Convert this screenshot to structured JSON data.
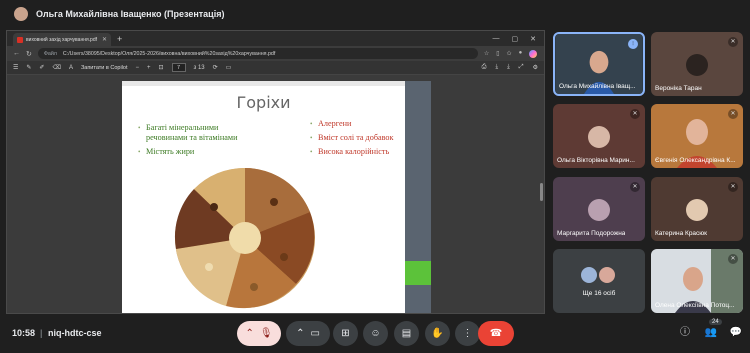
{
  "meeting": {
    "presenter_title": "Ольга Михайлівна Іващенко (Презентація)",
    "time": "10:58",
    "separator": "|",
    "code": "niq-hdtc-cse",
    "participants_badge": "24"
  },
  "browser": {
    "tab_title": "виховний захід харчування.pdf",
    "address_label": "Файл",
    "url": "C:/Users/38095/Desktop/Оля/2025-2026/виховна/виховний%20захід%20харчування.pdf",
    "ask_copilot": "Запитати в Copilot",
    "page_current": "7",
    "page_total": "з 13"
  },
  "slide": {
    "title": "Горіхи",
    "left_bullets": [
      "Багаті мінеральними речовинами та вітамінами",
      "Містять жири"
    ],
    "right_bullets": [
      "Алергени",
      "Вміст солі та добавок",
      "Висока калорійність"
    ]
  },
  "participants": [
    {
      "name": "Ольга Михайлівна Іващ...",
      "status": "speaking"
    },
    {
      "name": "Вероніка Таран",
      "status": "muted"
    },
    {
      "name": "Ольга Вікторівна Марин...",
      "status": "muted"
    },
    {
      "name": "Євгенія Олександрівна К...",
      "status": "muted"
    },
    {
      "name": "Маргарита Подорожна",
      "status": "muted"
    },
    {
      "name": "Катерина Красюк",
      "status": "muted"
    },
    {
      "name": "Ще 16 осіб",
      "status": "none"
    },
    {
      "name": "Олена Олексіївна Потоц...",
      "status": "muted"
    }
  ],
  "colors": {
    "accent": "#8ab4f8",
    "hangup": "#ea4335",
    "slide_green": "#3d7b24",
    "slide_red": "#c0392b"
  }
}
